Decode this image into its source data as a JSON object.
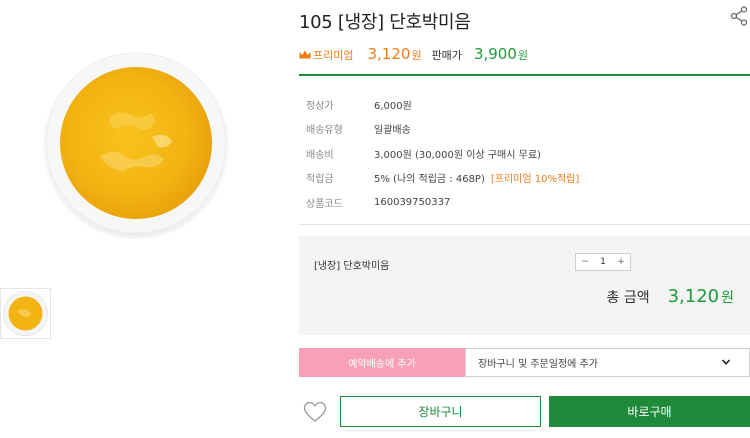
{
  "product": {
    "title": "105 [냉장] 단호박미음",
    "image_alt_icon": "pumpkin-porridge-bowl",
    "thumbnail_icon": "pumpkin-porridge-thumbnail"
  },
  "pricing": {
    "premium_label": "프리미엄",
    "premium_price": "3,120",
    "premium_unit": "원",
    "sale_label": "판매가",
    "sale_price": "3,900",
    "sale_unit": "원"
  },
  "details": [
    {
      "label": "정상가",
      "value": "6,000원"
    },
    {
      "label": "배송유형",
      "value": "일괄배송"
    },
    {
      "label": "배송비",
      "value": "3,000원 (30,000원 이상 구매시 무료)"
    },
    {
      "label": "적립금",
      "value": "5% (나의 적립금 : 468P)",
      "extra": "[프리미엄 10%적립]"
    },
    {
      "label": "상품코드",
      "value": "160039750337"
    }
  ],
  "option": {
    "name": "[냉장] 단호박미음",
    "minus": "−",
    "quantity": "1",
    "plus": "+",
    "total_label": "총 금액",
    "total_price": "3,120",
    "total_unit": "원"
  },
  "actions": {
    "reserve_label": "예약배송에 추가",
    "cart_select_value": "장바구니 및 주문일정에 추가",
    "cart_label": "장바구니",
    "buy_label": "바로구매"
  },
  "colors": {
    "accent_green": "#1e8a3a",
    "price_green": "#1e9a38",
    "premium_orange": "#f07a16",
    "reserve_pink": "#f8a0b8"
  },
  "icons": {
    "share": "share-icon",
    "crown": "crown-icon",
    "heart": "heart-icon",
    "chevron": "chevron-down-icon"
  }
}
